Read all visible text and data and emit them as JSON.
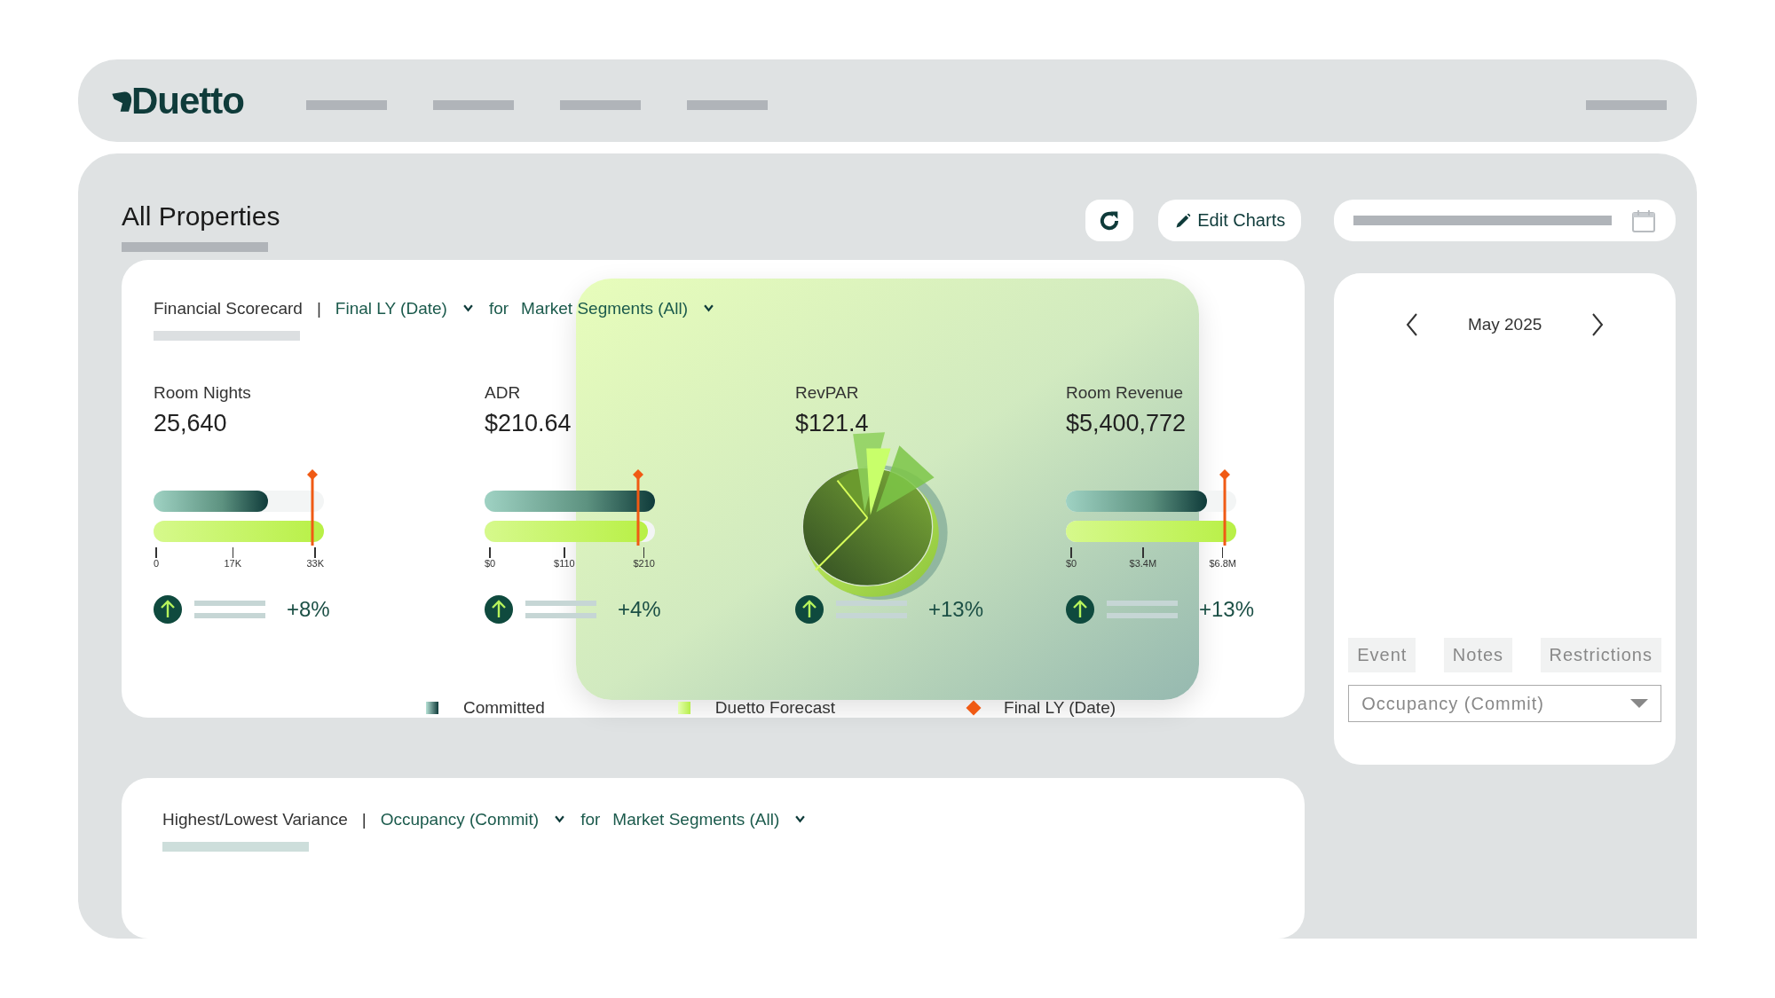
{
  "header": {
    "logo": "Duetto"
  },
  "page": {
    "title": "All Properties",
    "edit_button": "Edit Charts"
  },
  "scorecard": {
    "title": "Financial Scorecard",
    "separator": "|",
    "measure": "Final LY (Date)",
    "for": "for",
    "segment": "Market Segments (All)",
    "metrics": [
      {
        "label": "Room Nights",
        "value": "25,640",
        "bars": [
          {
            "kind": "committed",
            "level": 0.67
          },
          {
            "kind": "forecast",
            "level": 1.0
          }
        ],
        "marker": {
          "level": 0.93
        },
        "ticks": [
          "0",
          "17K",
          "33K"
        ],
        "change": "+8%"
      },
      {
        "label": "ADR",
        "value": "$210.64",
        "bars": [
          {
            "kind": "committed",
            "level": 1.0
          },
          {
            "kind": "forecast",
            "level": 0.96
          }
        ],
        "marker": {
          "level": 0.9
        },
        "ticks": [
          "$0",
          "$110",
          "$210"
        ],
        "change": "+4%"
      },
      {
        "label": "RevPAR",
        "value": "$121.4",
        "change": "+13%"
      },
      {
        "label": "Room Revenue",
        "value": "$5,400,772",
        "bars": [
          {
            "kind": "committed",
            "level": 0.83
          },
          {
            "kind": "forecast",
            "level": 1.0
          }
        ],
        "marker": {
          "level": 0.93
        },
        "ticks": [
          "$0",
          "$3.4M",
          "$6.8M"
        ],
        "change": "+13%"
      }
    ],
    "legend": [
      {
        "kind": "committed",
        "label": "Committed"
      },
      {
        "kind": "forecast",
        "label": "Duetto Forecast"
      },
      {
        "kind": "marker",
        "label": "Final LY (Date)"
      }
    ]
  },
  "calendar": {
    "month": "May 2025",
    "buttons": [
      "Event",
      "Notes",
      "Restrictions"
    ],
    "dropdown": "Occupancy (Commit)"
  },
  "variance": {
    "title": "Highest/Lowest Variance",
    "separator": "|",
    "measure": "Occupancy (Commit)",
    "for": "for",
    "segment": "Market Segments (All)"
  }
}
